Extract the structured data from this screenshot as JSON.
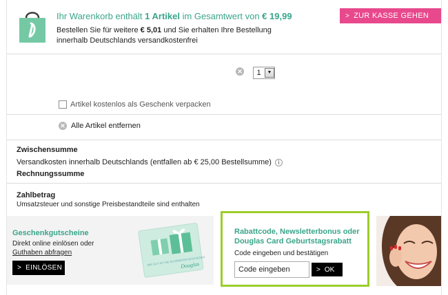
{
  "header": {
    "cart_prefix": "Ihr Warenkorb enthält ",
    "cart_count": "1 Artikel",
    "cart_mid": " im Gesamtwert von ",
    "cart_total": "€ 19,99",
    "info_prefix": "Bestellen Sie für weitere ",
    "info_amount": "€ 5,01",
    "info_suffix": " und Sie erhalten Ihre Bestellung innerhalb Deutschlands versandkostenfrei",
    "checkout_label": "ZUR KASSE GEHEN"
  },
  "item": {
    "quantity": "1"
  },
  "options": {
    "gift_wrap_label": "Artikel kostenlos als Geschenk verpacken",
    "remove_all_label": "Alle Artikel entfernen"
  },
  "summary": {
    "subtotal_label": "Zwischensumme",
    "shipping_label": "Versandkosten innerhalb Deutschlands (entfallen ab € 25,00 Bestellsumme)",
    "invoice_label": "Rechnungssumme",
    "total_label": "Zahlbetrag",
    "tax_note": "Umsatzsteuer und sonstige Preisbestandteile sind enthalten"
  },
  "gift_card": {
    "title": "Geschenkgutscheine",
    "line1": "Direkt online einlösen oder",
    "link": "Guthaben abfragen",
    "button": "EINLÖSEN",
    "card_text": "WIE GUT IST DIE SCHÖNSTEN GESCHENKIDEEN?",
    "card_brand": "Douglas"
  },
  "coupon": {
    "title": "Rabattcode, Newsletterbonus oder Douglas Card Geburtstagsrabatt",
    "subtitle": "Code eingeben und bestätigen",
    "input_value": "Code eingeben",
    "button": "OK"
  },
  "colors": {
    "accent_green": "#3aa58a",
    "checkout_pink": "#e8488c",
    "frame_lime": "#9bcd29"
  }
}
